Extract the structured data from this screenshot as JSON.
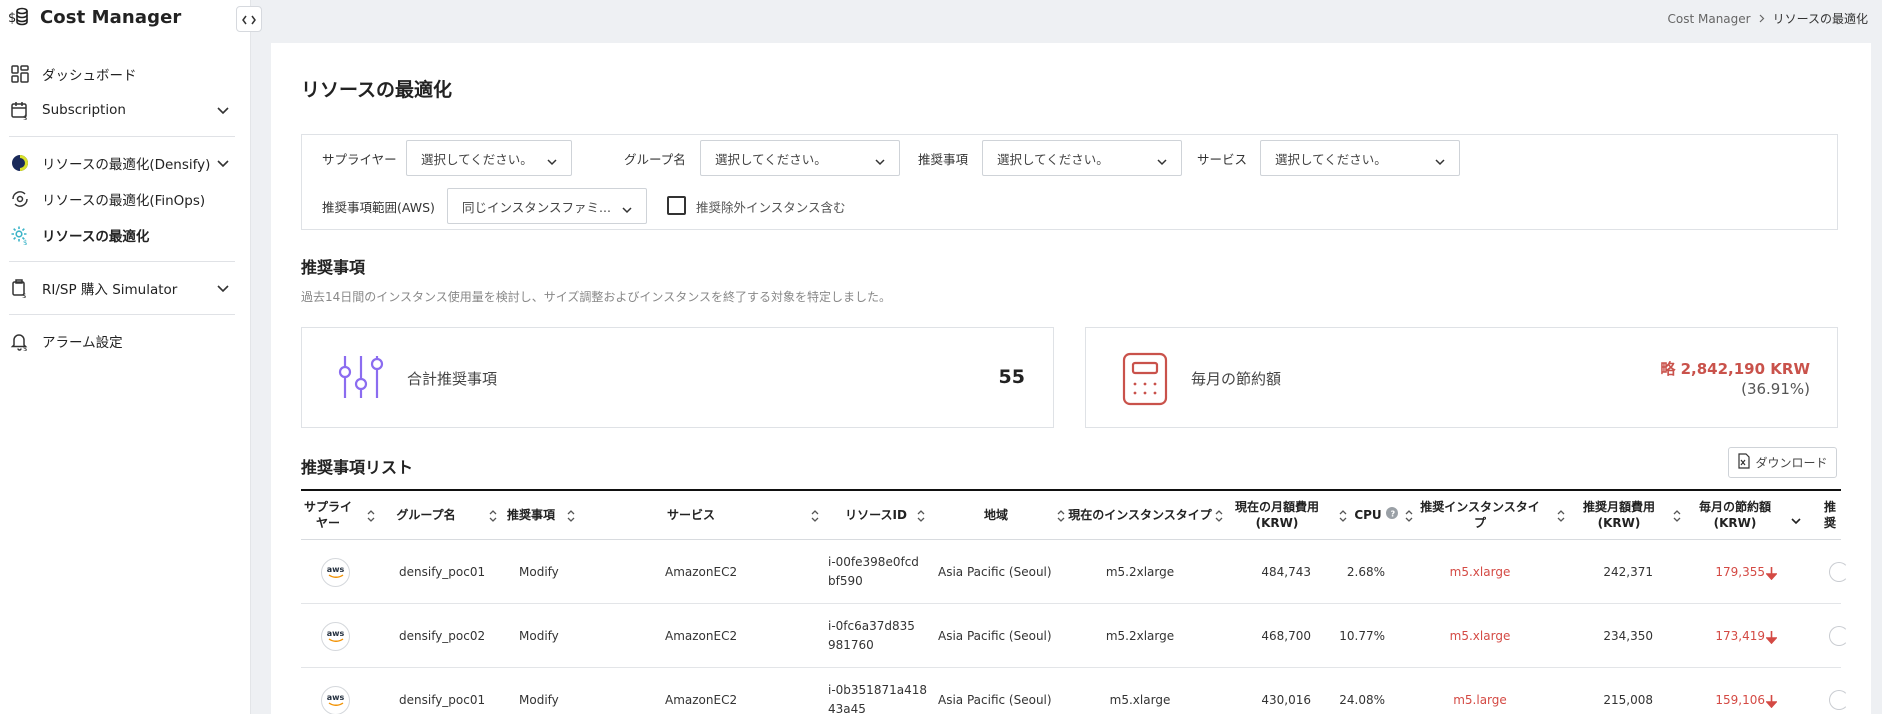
{
  "app": {
    "title": "Cost Manager"
  },
  "sidebar": {
    "items": [
      {
        "label": "ダッシュボード",
        "icon": "dashboard-grid-icon"
      },
      {
        "label": "Subscription",
        "icon": "calendar-dollar-icon",
        "expandable": true
      },
      {
        "label": "リソースの最適化(Densify)",
        "icon": "densify-logo-icon",
        "expandable": true
      },
      {
        "label": "リソースの最適化(FinOps)",
        "icon": "eye-cycle-icon"
      },
      {
        "label": "リソースの最適化",
        "icon": "gear-dollar-icon",
        "active": true
      },
      {
        "label": "RI/SP 購入 Simulator",
        "icon": "document-dollar-icon",
        "expandable": true
      },
      {
        "label": "アラーム設定",
        "icon": "bell-dollar-icon"
      }
    ]
  },
  "breadcrumb": {
    "root": "Cost Manager",
    "current": "リソースの最適化"
  },
  "page": {
    "title": "リソースの最適化"
  },
  "filters": {
    "supplier": {
      "label": "サプライヤー",
      "value": "選択してください。"
    },
    "group": {
      "label": "グループ名",
      "value": "選択してください。"
    },
    "recommendation": {
      "label": "推奨事項",
      "value": "選択してください。"
    },
    "service": {
      "label": "サービス",
      "value": "選択してください。"
    },
    "scope": {
      "label": "推奨事項範囲(AWS)",
      "value": "同じインスタンスファミ..."
    },
    "exclude": {
      "label": "推奨除外インスタンス含む",
      "checked": false
    }
  },
  "summary": {
    "title": "推奨事項",
    "description": "過去14日間のインスタンス使用量を検討し、サイズ調整およびインスタンスを終了する対象を特定しました。",
    "total": {
      "label": "合計推奨事項",
      "value": "55"
    },
    "savings": {
      "label": "毎月の節約額",
      "value": "略 2,842,190 KRW",
      "percent": "(36.91%)"
    }
  },
  "list": {
    "title": "推奨事項リスト",
    "download_label": "ダウンロード",
    "columns": {
      "supplier": "サプライヤー",
      "group": "グループ名",
      "recommendation": "推奨事項",
      "service": "サービス",
      "resource_id": "リソースID",
      "region": "地域",
      "current_type": "現在のインスタンスタイプ",
      "current_cost_a": "現在の月額費用",
      "current_cost_b": "(KRW)",
      "cpu": "CPU",
      "rec_type": "推奨インスタンスタイプ",
      "rec_cost_a": "推奨月額費用",
      "rec_cost_b": "(KRW)",
      "saving_a": "毎月の節約額",
      "saving_b": "(KRW)",
      "extra": "推奨"
    },
    "rows": [
      {
        "supplier": "aws",
        "group": "densify_poc01",
        "recommendation": "Modify",
        "service": "AmazonEC2",
        "resource_id_1": "i-00fe398e0fcd",
        "resource_id_2": "bf590",
        "region": "Asia Pacific (Seoul)",
        "current_type": "m5.2xlarge",
        "current_cost": "484,743",
        "cpu": "2.68%",
        "rec_type": "m5.xlarge",
        "rec_cost": "242,371",
        "saving": "179,355"
      },
      {
        "supplier": "aws",
        "group": "densify_poc02",
        "recommendation": "Modify",
        "service": "AmazonEC2",
        "resource_id_1": "i-0fc6a37d835",
        "resource_id_2": "981760",
        "region": "Asia Pacific (Seoul)",
        "current_type": "m5.2xlarge",
        "current_cost": "468,700",
        "cpu": "10.77%",
        "rec_type": "m5.xlarge",
        "rec_cost": "234,350",
        "saving": "173,419"
      },
      {
        "supplier": "aws",
        "group": "densify_poc01",
        "recommendation": "Modify",
        "service": "AmazonEC2",
        "resource_id_1": "i-0b351871a418",
        "resource_id_2": "43a45",
        "region": "Asia Pacific (Seoul)",
        "current_type": "m5.xlarge",
        "current_cost": "430,016",
        "cpu": "24.08%",
        "rec_type": "m5.large",
        "rec_cost": "215,008",
        "saving": "159,106"
      }
    ]
  },
  "colors": {
    "accent": "#3cb4c8",
    "savings_red": "#d44a44",
    "kpi_purple": "#8b6cf0",
    "kpi_red": "#c9524b"
  }
}
